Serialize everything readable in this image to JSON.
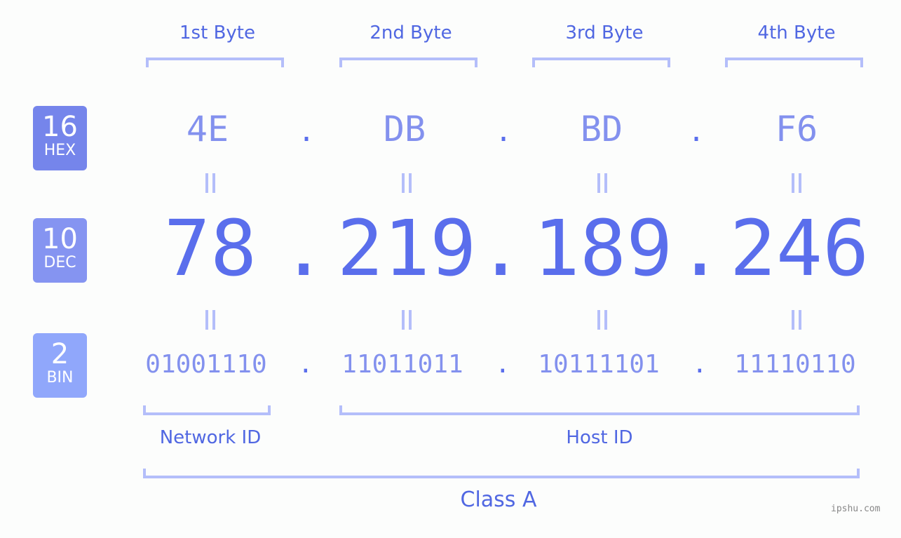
{
  "bytes": [
    {
      "label": "1st Byte",
      "hex": "4E",
      "dec": "78",
      "bin": "01001110"
    },
    {
      "label": "2nd Byte",
      "hex": "DB",
      "dec": "219",
      "bin": "11011011"
    },
    {
      "label": "3rd Byte",
      "hex": "BD",
      "dec": "189",
      "bin": "10111101"
    },
    {
      "label": "4th Byte",
      "hex": "F6",
      "dec": "246",
      "bin": "11110110"
    }
  ],
  "separator": ".",
  "badges": {
    "hex": {
      "num": "16",
      "label": "HEX",
      "color": "#7585eb"
    },
    "dec": {
      "num": "10",
      "label": "DEC",
      "color": "#8594f1"
    },
    "bin": {
      "num": "2",
      "label": "BIN",
      "color": "#90a7fb"
    }
  },
  "network_id_label": "Network ID",
  "host_id_label": "Host ID",
  "class_label": "Class A",
  "watermark": "ipshu.com"
}
